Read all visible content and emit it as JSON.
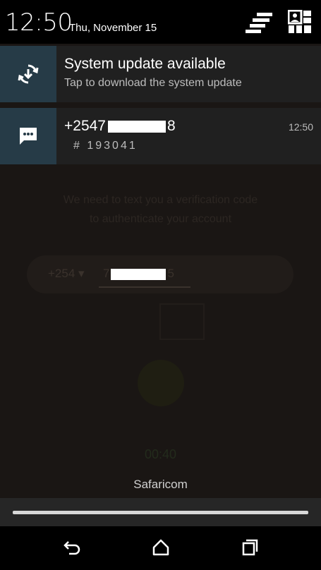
{
  "status_bar": {
    "time": "12:50",
    "date": "Thu, November 15",
    "settings_icon": "settings-bars-icon",
    "quick_settings_icon": "quick-settings-icon"
  },
  "notifications": [
    {
      "icon": "system-update-icon",
      "title": "System update available",
      "subtitle": "Tap to download the system update"
    },
    {
      "icon": "message-icon",
      "title_prefix": "+2547",
      "title_suffix": "8",
      "subtitle": "# 193041",
      "time": "12:50"
    }
  ],
  "background_app": {
    "line1": "We need to text you a verification code",
    "line2": "to authenticate your account",
    "country_code": "+254 ▾",
    "phone_prefix": "7",
    "phone_suffix": "5",
    "timer": "00:40"
  },
  "carrier": "Safaricom",
  "navigation": {
    "back_icon": "back-icon",
    "home_icon": "home-icon",
    "recents_icon": "recents-icon"
  },
  "colors": {
    "notification_icon_bg": "#263b47",
    "notification_bg": "#202020"
  }
}
